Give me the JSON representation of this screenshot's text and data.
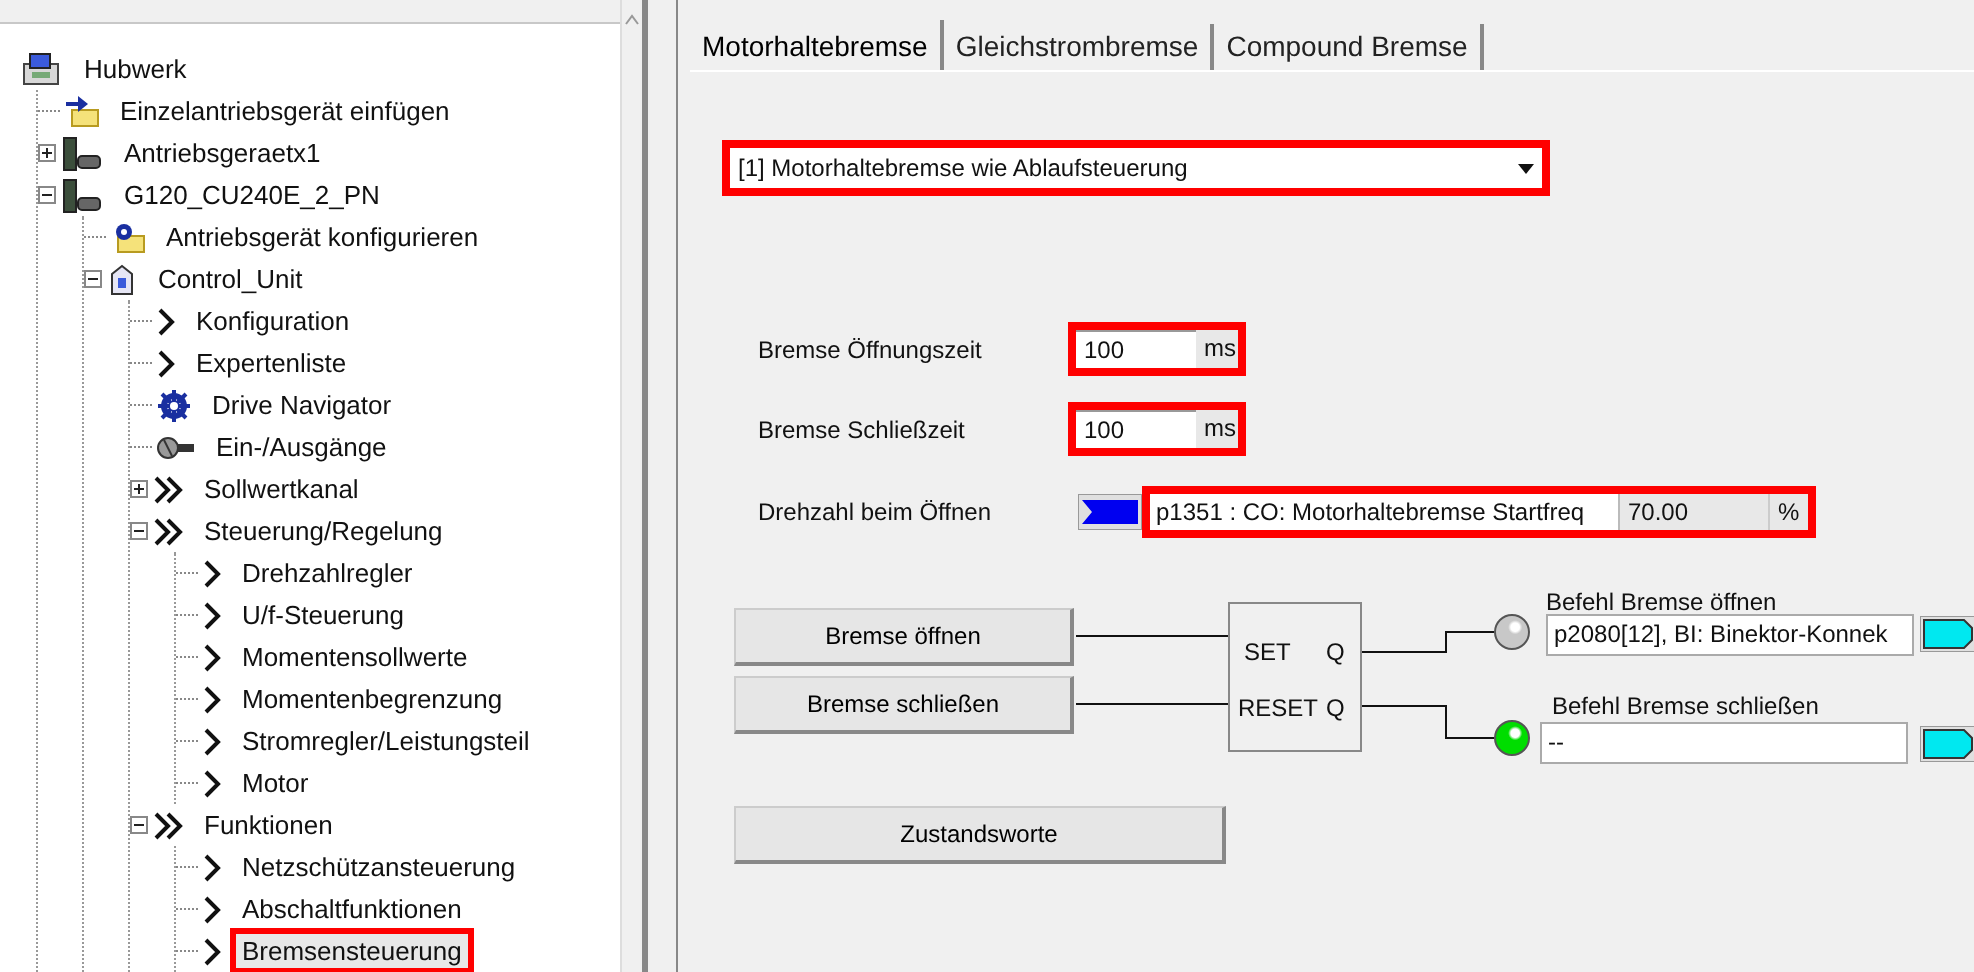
{
  "tree": [
    {
      "label": "Hubwerk",
      "kind": "project",
      "selected": false,
      "highlighted": false,
      "children": [
        {
          "label": "Einzelantriebsgerät einfügen",
          "kind": "insert",
          "selected": false,
          "highlighted": false
        },
        {
          "label": "Antriebsgeraetx1",
          "kind": "drive",
          "expanded": false,
          "selected": false,
          "highlighted": false
        },
        {
          "label": "G120_CU240E_2_PN",
          "kind": "drive",
          "expanded": true,
          "selected": false,
          "highlighted": false,
          "children": [
            {
              "label": "Antriebsgerät konfigurieren",
              "kind": "config",
              "selected": false,
              "highlighted": false
            },
            {
              "label": "Control_Unit",
              "kind": "unit",
              "expanded": true,
              "selected": false,
              "highlighted": false,
              "children": [
                {
                  "label": "Konfiguration",
                  "kind": "chevron",
                  "selected": false,
                  "highlighted": false
                },
                {
                  "label": "Expertenliste",
                  "kind": "chevron",
                  "selected": false,
                  "highlighted": false
                },
                {
                  "label": "Drive Navigator",
                  "kind": "navigator",
                  "selected": false,
                  "highlighted": false
                },
                {
                  "label": "Ein-/Ausgänge",
                  "kind": "io",
                  "selected": false,
                  "highlighted": false
                },
                {
                  "label": "Sollwertkanal",
                  "kind": "double-chevron",
                  "expanded": false,
                  "selected": false,
                  "highlighted": false
                },
                {
                  "label": "Steuerung/Regelung",
                  "kind": "double-chevron",
                  "expanded": true,
                  "selected": false,
                  "highlighted": false,
                  "children": [
                    {
                      "label": "Drehzahlregler",
                      "kind": "chevron",
                      "selected": false,
                      "highlighted": false
                    },
                    {
                      "label": "U/f-Steuerung",
                      "kind": "chevron",
                      "selected": false,
                      "highlighted": false
                    },
                    {
                      "label": "Momentensollwerte",
                      "kind": "chevron",
                      "selected": false,
                      "highlighted": false
                    },
                    {
                      "label": "Momentenbegrenzung",
                      "kind": "chevron",
                      "selected": false,
                      "highlighted": false
                    },
                    {
                      "label": "Stromregler/Leistungsteil",
                      "kind": "chevron",
                      "selected": false,
                      "highlighted": false
                    },
                    {
                      "label": "Motor",
                      "kind": "chevron",
                      "selected": false,
                      "highlighted": false
                    }
                  ]
                },
                {
                  "label": "Funktionen",
                  "kind": "double-chevron",
                  "expanded": true,
                  "selected": false,
                  "highlighted": false,
                  "children": [
                    {
                      "label": "Netzschützansteuerung",
                      "kind": "chevron",
                      "selected": false,
                      "highlighted": false
                    },
                    {
                      "label": "Abschaltfunktionen",
                      "kind": "chevron",
                      "selected": false,
                      "highlighted": false
                    },
                    {
                      "label": "Bremsensteuerung",
                      "kind": "chevron",
                      "selected": true,
                      "highlighted": true
                    }
                  ]
                }
              ]
            }
          ]
        }
      ]
    }
  ],
  "tabs": [
    {
      "label": "Motorhaltebremse",
      "selected": true
    },
    {
      "label": "Gleichstrombremse",
      "selected": false
    },
    {
      "label": "Compound Bremse",
      "selected": false
    }
  ],
  "mode_dropdown": {
    "value": "[1] Motorhaltebremse wie Ablaufsteuerung",
    "highlighted": true
  },
  "time_fields": [
    {
      "label": "Bremse Öffnungszeit",
      "value": "100",
      "unit": "ms",
      "highlighted": true
    },
    {
      "label": "Bremse Schließzeit",
      "value": "100",
      "unit": "ms",
      "highlighted": true
    }
  ],
  "speed": {
    "label": "Drehzahl beim Öffnen",
    "parameter": "p1351 : CO: Motorhaltebremse Startfreq",
    "value": "70.00",
    "unit": "%",
    "highlighted": true
  },
  "logic": {
    "buttons": [
      "Bremse öffnen",
      "Bremse schließen"
    ],
    "flipflop": {
      "inputs": [
        "SET",
        "RESET"
      ],
      "outputs": [
        "Q",
        "Q"
      ]
    },
    "outputs": [
      {
        "label": "Befehl Bremse öffnen",
        "value": "p2080[12], BI: Binektor-Konnek",
        "on": false
      },
      {
        "label": "Befehl Bremse schließen",
        "value": "--",
        "on": true
      }
    ]
  },
  "status_button": "Zustandsworte"
}
